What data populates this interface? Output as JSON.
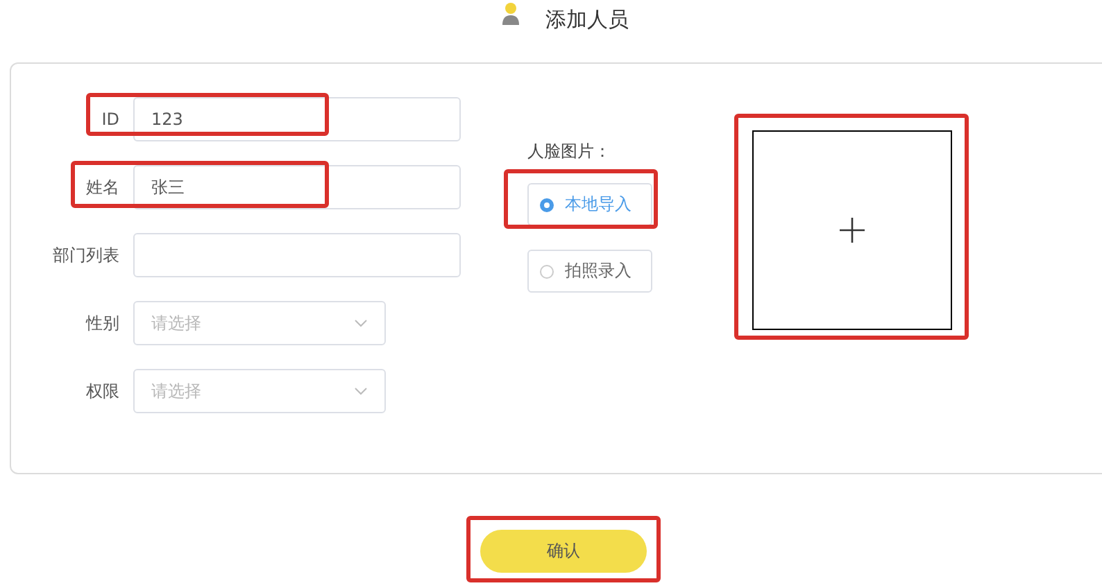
{
  "header": {
    "title": "添加人员"
  },
  "fields": [
    {
      "label": "ID",
      "kind": "text",
      "value": "123",
      "highlighted": true
    },
    {
      "label": "姓名",
      "kind": "text",
      "value": "张三",
      "highlighted": true
    },
    {
      "label": "部门列表",
      "kind": "text",
      "highlighted": false
    },
    {
      "label": "性别",
      "kind": "select",
      "placeholder": "请选择",
      "highlighted": false
    },
    {
      "label": "权限",
      "kind": "select",
      "placeholder": "请选择",
      "highlighted": false
    }
  ],
  "face_source": {
    "label": "人脸图片：",
    "options": [
      {
        "label": "本地导入",
        "selected": true,
        "highlighted": true
      },
      {
        "label": "拍照录入",
        "selected": false,
        "highlighted": false
      }
    ]
  },
  "upload": {
    "highlighted": true
  },
  "confirm": {
    "label": "确认",
    "highlighted": true
  }
}
